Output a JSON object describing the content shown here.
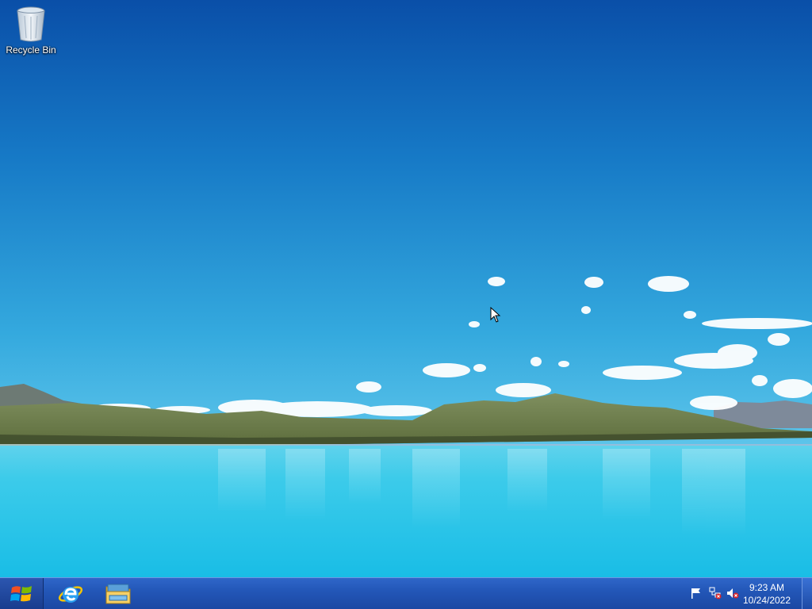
{
  "desktop": {
    "icons": [
      {
        "label": "Recycle Bin",
        "icon": "recycle-bin-icon"
      }
    ]
  },
  "taskbar": {
    "start": {
      "icon": "windows-logo-icon"
    },
    "pinned": [
      {
        "name": "Internet Explorer",
        "icon": "internet-explorer-icon"
      },
      {
        "name": "File Explorer",
        "icon": "folder-icon"
      }
    ],
    "tray": {
      "icons": [
        "action-center-flag-icon",
        "network-disconnected-icon",
        "volume-muted-icon"
      ],
      "time": "9:23 AM",
      "date": "10/24/2022"
    }
  },
  "colors": {
    "taskbar": "#2357b8",
    "sky_top": "#0a4fa8",
    "sky_bottom": "#3fb6e3",
    "lake": "#25c3e6"
  }
}
